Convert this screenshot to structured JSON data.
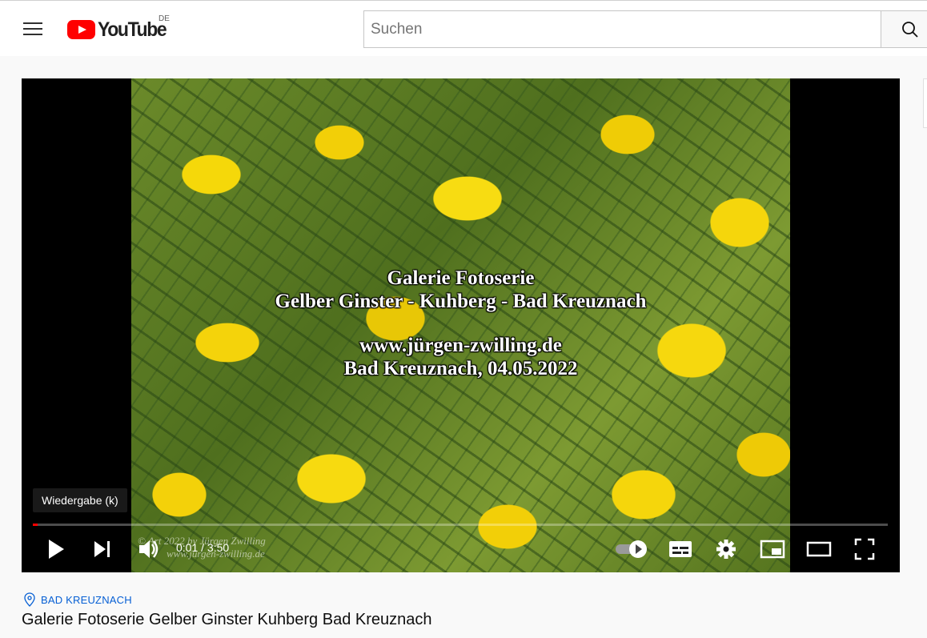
{
  "header": {
    "logo_text": "YouTube",
    "country_code": "DE",
    "search_placeholder": "Suchen",
    "icons": {
      "menu": "hamburger-menu-icon",
      "search": "search-icon"
    }
  },
  "player": {
    "overlay_lines": [
      "Galerie Fotoserie",
      "Gelber Ginster - Kuhberg - Bad Kreuznach",
      "www.jürgen-zwilling.de",
      "Bad Kreuznach, 04.05.2022"
    ],
    "watermark_line1": "© Art 2022 by Jürgen Zwilling",
    "watermark_line2": "www.jürgen-zwilling.de",
    "tooltip": "Wiedergabe (k)",
    "time_display": "0:01 / 3:50",
    "progress_fraction": 0.005,
    "accent_color": "#ff0000",
    "icons": {
      "play": "play-icon",
      "next": "next-icon",
      "volume": "volume-icon",
      "autoplay": "autoplay-toggle-icon",
      "subtitles": "subtitles-icon",
      "settings": "settings-icon",
      "miniplayer": "miniplayer-icon",
      "theater": "theater-mode-icon",
      "fullscreen": "fullscreen-icon"
    }
  },
  "video_info": {
    "location": "BAD KREUZNACH",
    "title": "Galerie Fotoserie Gelber Ginster Kuhberg Bad Kreuznach"
  }
}
